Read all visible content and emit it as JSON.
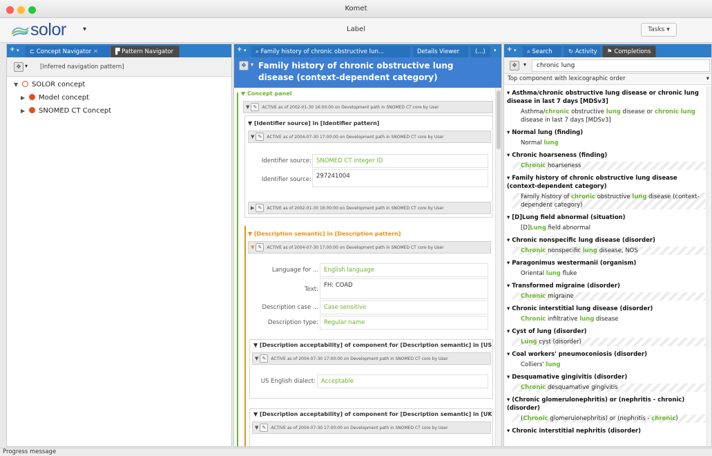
{
  "window": {
    "title": "Komet"
  },
  "header": {
    "logo_text": "solor",
    "center_label": "Label",
    "tasks_label": "Tasks ▾"
  },
  "left_panel": {
    "tabs": [
      {
        "label": "Concept Navigator"
      },
      {
        "label": "Pattern Navigator"
      }
    ],
    "nav_pattern": "[Inferred navigation pattern]",
    "tree": [
      {
        "label": "SOLOR concept",
        "color": "#e84e1b",
        "hollow": true
      },
      {
        "label": "Model concept",
        "color": "#e84e1b",
        "hollow": false
      },
      {
        "label": "SNOMED CT Concept",
        "color": "#e84e1b",
        "hollow": false
      }
    ]
  },
  "middle_panel": {
    "tabs": [
      {
        "label": "Family history of chronic obstructive lun..."
      },
      {
        "label": "Details Viewer"
      },
      {
        "label": "(...)"
      }
    ],
    "title": "Family history of chronic obstructive lung disease (context-dependent category)",
    "concept_panel_label": "Concept panel",
    "stamp_2002": "ACTIVE as of 2002-01-30 16:00:00 on Development path in SNOMED CT core by User",
    "identifier_section": "[Identifier source] in [Identifier pattern]",
    "stamp_2004": "ACTIVE as of 2004-07-30 17:00:00 on Development path in SNOMED CT core by User",
    "id_source_label": "Identifier source:",
    "id_source_value": "SNOMED CT integer ID",
    "id_source_label2": "Identifier source:",
    "id_value": "297241004",
    "description_section": "[Description semantic] in [Description pattern]",
    "lang_label": "Language for ...",
    "lang_value": "English language",
    "text_label": "Text:",
    "text_value": "FH: COAD",
    "case_label": "Description case ...",
    "case_value": "Case sensitive",
    "type_label": "Description type:",
    "type_value": "Regular name",
    "accept_section_us": "[Description acceptability] of component for [Description semantic] in [US",
    "dialect_label": "US English dialect:",
    "dialect_value": "Acceptable",
    "accept_section_uk": "[Description acceptability] of component for [Description semantic] in [UK"
  },
  "right_panel": {
    "tabs": [
      {
        "label": "Search"
      },
      {
        "label": "Activity"
      },
      {
        "label": "Completions"
      }
    ],
    "query": "chronic lung",
    "order_label": "Top component with lexicographic order",
    "results": [
      {
        "title": "Asthma/chronic obstructive lung disease or chronic lung disease in last 7 days [MDSv3]",
        "detail": "Asthma/<b class='hl'>chronic</b> obstructive <b class='hl'>lung</b> disease or <b class='hl'>chronic</b> <b class='hl'>lung</b> disease in last 7 days [MDSv3]",
        "hatch": false
      },
      {
        "title": "Normal lung (finding)",
        "detail": "Normal <b class='hl'>lung</b>",
        "hatch": false
      },
      {
        "title": "Chronic hoarseness (finding)",
        "detail": "<b class='hl'>Chronic</b> hoarseness",
        "hatch": true
      },
      {
        "title": "Family history of chronic obstructive lung disease (context-dependent category)",
        "detail": "Family history of <b class='hl'>chronic</b> obstructive <b class='hl'>lung</b> disease (context-dependent category)",
        "hatch": true
      },
      {
        "title": "[D]Lung field abnormal (situation)",
        "detail": "[D]<b class='hl'>Lung</b> field abnormal",
        "hatch": false
      },
      {
        "title": "Chronic nonspecific lung disease (disorder)",
        "detail": "<b class='hl'>Chronic</b> nonspecific <b class='hl'>lung</b> disease, NOS",
        "hatch": true
      },
      {
        "title": "Paragonimus westermanii (organism)",
        "detail": "Oriental <b class='hl'>lung</b> fluke",
        "hatch": false
      },
      {
        "title": "Transformed migraine (disorder)",
        "detail": "<b class='hl'>Chronic</b> migraine",
        "hatch": true
      },
      {
        "title": "Chronic interstitial lung disease (disorder)",
        "detail": "<b class='hl'>Chronic</b> infiltrative <b class='hl'>lung</b> disease",
        "hatch": false
      },
      {
        "title": "Cyst of lung (disorder)",
        "detail": "<b class='hl'>Lung</b> cyst (disorder)",
        "hatch": true
      },
      {
        "title": "Coal workers' pneumoconiosis (disorder)",
        "detail": "Colliers' <b class='hl'>lung</b>",
        "hatch": false
      },
      {
        "title": "Desquamative gingivitis (disorder)",
        "detail": "<b class='hl'>Chronic</b> desquamative gingivitis",
        "hatch": true
      },
      {
        "title": "(Chronic glomerulonephritis) or (nephritis - chronic) (disorder)",
        "detail": "(<b class='hl'>Chronic</b> glomerulonephritis) or (nephritis - <b class='hl'>chronic</b>)",
        "hatch": true
      },
      {
        "title": "Chronic interstitial nephritis (disorder)",
        "detail": "",
        "hatch": false
      }
    ]
  },
  "status": {
    "message": "Progress message"
  },
  "colors": {
    "accent_blue": "#2e7ec9",
    "green": "#6ab52b",
    "orange": "#e89016"
  }
}
